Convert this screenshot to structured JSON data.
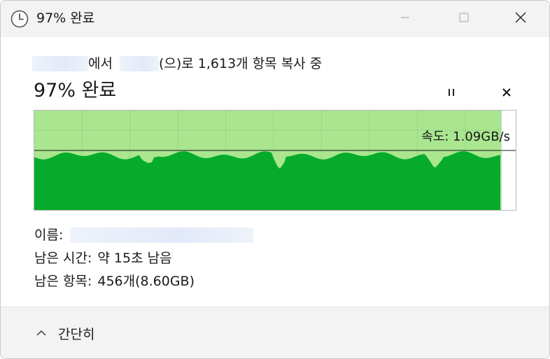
{
  "window": {
    "title": "97% 완료",
    "minimize_icon": "minimize-icon",
    "maximize_icon": "maximize-icon",
    "close_icon": "close-icon",
    "title_icon": "clock-icon"
  },
  "copy": {
    "from_suffix": "에서",
    "to_suffix": "(으)로 1,613개 항목 복사 중",
    "source_hint": "s",
    "progress_percent": 97,
    "status": "97% 완료",
    "speed_label": "속도: 1.09GB/s"
  },
  "colors": {
    "progress_fill": "#06ab2b",
    "progress_bg": "#a9e68f",
    "titlebar": "#f3f3f3"
  },
  "info": {
    "name_label": "이름:",
    "name_value": "",
    "time_label": "남은 시간:",
    "time_value": "약 15초 남음",
    "items_label": "남은 항목:",
    "items_value": "456개(8.60GB)"
  },
  "footer": {
    "toggle_label": "간단히",
    "toggle_icon": "chevron-up-icon"
  }
}
